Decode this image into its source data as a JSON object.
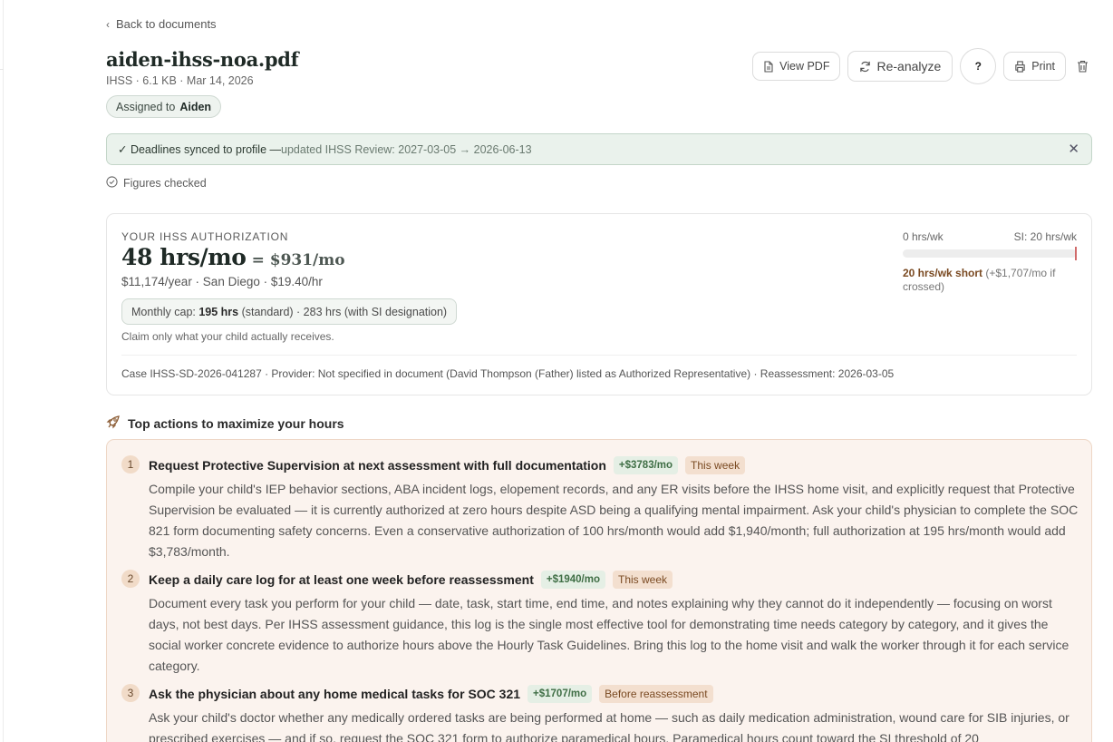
{
  "nav": {
    "back_label": "Back to documents"
  },
  "document": {
    "title": "aiden-ihss-noa.pdf",
    "meta": "IHSS · 6.1 KB · Mar 14, 2026",
    "assigned_prefix": "Assigned to",
    "assigned_name": "Aiden"
  },
  "toolbar": {
    "view_pdf": "View PDF",
    "reanalyze": "Re-analyze",
    "help": "?",
    "print": "Print"
  },
  "banner": {
    "lead": "✓ Deadlines synced to profile — ",
    "detail": "updated IHSS Review: 2027-03-05 → 2026-06-13",
    "close": "✕"
  },
  "checked_label": "Figures checked",
  "authorization": {
    "eyebrow": "YOUR IHSS AUTHORIZATION",
    "hours": "48 hrs/mo",
    "monthly_value": "= $931/mo",
    "sub": "$11,174/year · San Diego · $19.40/hr",
    "cap_prefix": "Monthly cap: ",
    "cap_standard": "195 hrs",
    "cap_suffix": " (standard) · 283 hrs (with SI designation)",
    "claim_note": "Claim only what your child actually receives.",
    "case_line": "Case IHSS-SD-2026-041287 · Provider: Not specified in document (David Thompson (Father) listed as Authorized Representative) · Reassessment: 2026-03-05"
  },
  "si_gauge": {
    "min_label": "0 hrs/wk",
    "max_label": "SI: 20 hrs/wk",
    "current_hrs_wk": 0,
    "threshold_hrs_wk": 20,
    "shortfall": "20 hrs/wk short",
    "shortfall_note": " (+$1,707/mo if crossed)"
  },
  "actions": {
    "heading": "Top actions to maximize your hours",
    "items": [
      {
        "num": "1",
        "title": "Request Protective Supervision at next assessment with full documentation",
        "value": "+$3783/mo",
        "timing": "This week",
        "body": "Compile your child's IEP behavior sections, ABA incident logs, elopement records, and any ER visits before the IHSS home visit, and explicitly request that Protective Supervision be evaluated — it is currently authorized at zero hours despite ASD being a qualifying mental impairment. Ask your child's physician to complete the SOC 821 form documenting safety concerns. Even a conservative authorization of 100 hrs/month would add $1,940/month; full authorization at 195 hrs/month would add $3,783/month."
      },
      {
        "num": "2",
        "title": "Keep a daily care log for at least one week before reassessment",
        "value": "+$1940/mo",
        "timing": "This week",
        "body": "Document every task you perform for your child — date, task, start time, end time, and notes explaining why they cannot do it independently — focusing on worst days, not best days. Per IHSS assessment guidance, this log is the single most effective tool for demonstrating time needs category by category, and it gives the social worker concrete evidence to authorize hours above the Hourly Task Guidelines. Bring this log to the home visit and walk the worker through it for each service category."
      },
      {
        "num": "3",
        "title": "Ask the physician about any home medical tasks for SOC 321",
        "value": "+$1707/mo",
        "timing": "Before reassessment",
        "body": "Ask your child's doctor whether any medically ordered tasks are being performed at home — such as daily medication administration, wound care for SIB injuries, or prescribed exercises — and if so, request the SOC 321 form to authorize paramedical hours. Paramedical hours count toward the SI threshold of 20"
      }
    ]
  },
  "colors": {
    "accent_green_bg": "#eaf2ec",
    "action_card_bg": "#fbf3ee",
    "money_tag": "#3f6e45",
    "timing_tag": "#7a4a22",
    "threshold_marker": "#d06a6a"
  },
  "icons": [
    "chevron-left-icon",
    "file-icon",
    "refresh-icon",
    "printer-icon",
    "trash-icon",
    "check-circle-icon",
    "close-icon",
    "rocket-icon"
  ]
}
